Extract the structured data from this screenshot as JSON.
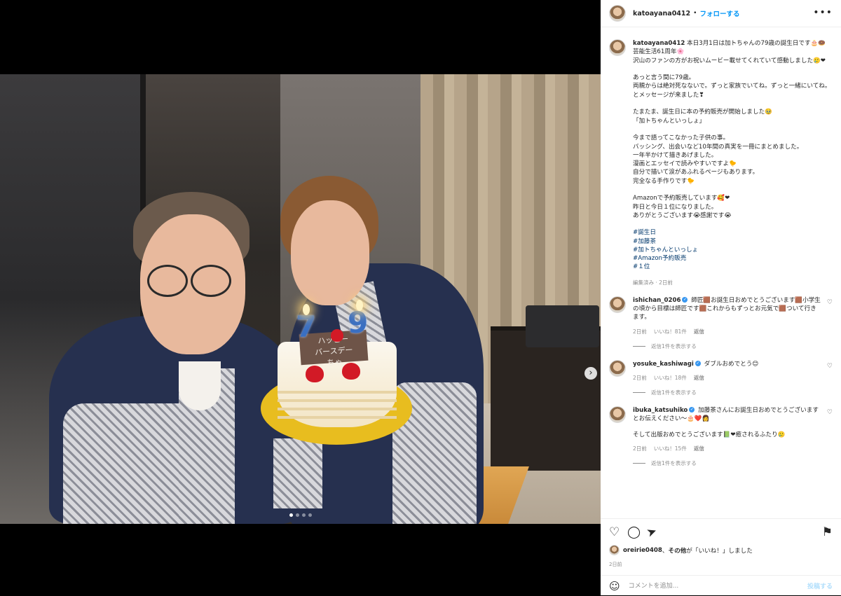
{
  "post": {
    "username": "katoayana0412",
    "follow_label": "フォローする",
    "dot": "•",
    "caption_lines": "本日3月1日は加トちゃんの79歳の誕生日です🎂🍩\n芸能生活61周年🌸\n沢山のファンの方がお祝いムービー載せてくれていて感動しました🥲❤\n\nあっと言う間に79歳。\n両親からは絶対死なないで。ずっと家族でいてね。ずっと一緒にいてね。\nとメッセージが来ました❣\n\nたまたま、誕生日に本の予約販売が開始しました🥹\n「加トちゃんといっしょ」\n\n今まで語ってこなかった子供の事。\nバッシング、出会いなど10年間の真実を一冊にまとめました。\n一年半かけて描きあげました。\n漫画とエッセイで読みやすいですよ🐤\n自分で描いて涙があふれるページもあります。\n完全なる手作りです🐤\n\nAmazonで予約販売しています🥰❤\n昨日と今日１位になりました。\nありがとうございます😭感謝です😭",
    "hashtags": [
      "#誕生日",
      "#加藤茶",
      "#加トちゃんといっしょ",
      "#Amazon予約販売",
      "#１位"
    ],
    "caption_meta": "編集済み · 2日前"
  },
  "photo": {
    "plaque_text": "ハッピー\nバースデー\nちゃ",
    "candles": [
      "7",
      "9"
    ],
    "carousel_next": "›"
  },
  "comments": [
    {
      "username": "ishichan_0206",
      "text": "師匠🟫お誕生日おめでとうございます🟫小学生の頃から目標は師匠です🟫これからもずっとお元気で🟫ついて行きます。",
      "time": "2日前",
      "likes": "いいね！81件",
      "reply": "返信",
      "view_replies": "返信1件を表示する"
    },
    {
      "username": "yosuke_kashiwagi",
      "text": "ダブルおめでとう😊",
      "time": "2日前",
      "likes": "いいね！18件",
      "reply": "返信",
      "view_replies": "返信1件を表示する"
    },
    {
      "username": "ibuka_katsuhiko",
      "text": "加藤茶さんにお誕生日おめでとうございますとお伝えください〜🎂❤️👩",
      "text2": "そして出版おめでとうございます📗❤癒されるふたり🥲",
      "time": "2日前",
      "likes": "いいね！15件",
      "reply": "返信",
      "view_replies": "返信1件を表示する"
    }
  ],
  "actions": {
    "heart_icon": "♡",
    "comment_icon": "◯",
    "share_icon": "➤",
    "save_icon": "⚑"
  },
  "likes": {
    "liker": "oreirie0408",
    "rest": "、",
    "others": "その他",
    "suffix": "が「いいね！」しました"
  },
  "date": "2日前",
  "comment_box": {
    "placeholder": "コメントを追加...",
    "post_label": "投稿する"
  },
  "colors": {
    "link_blue": "#0095f6",
    "hashtag_blue": "#00376b",
    "muted_gray": "#8e8e8e"
  }
}
